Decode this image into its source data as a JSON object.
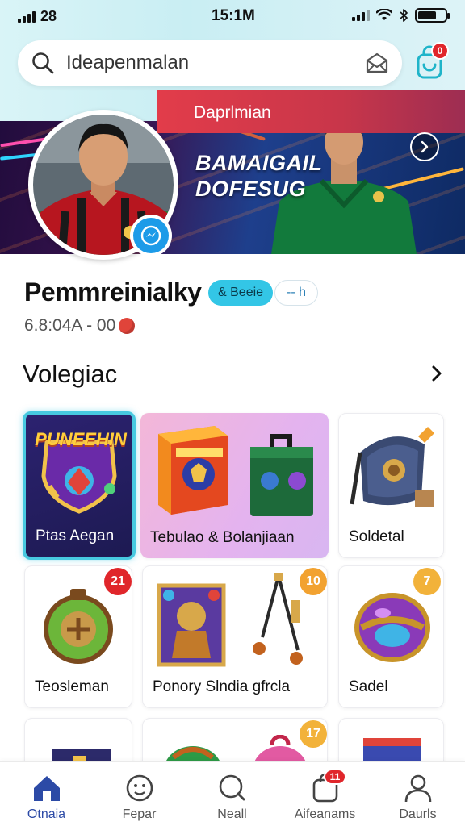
{
  "status_bar": {
    "carrier": "28",
    "time": "15:1M"
  },
  "search": {
    "value": "Ideapenmalan",
    "search_icon": "search-icon",
    "mail_icon": "mail-icon",
    "bag_icon": "shopping-bag-icon",
    "bag_badge": "0"
  },
  "hero": {
    "title_line1": "BAMAIGAIL",
    "title_line2": "DOFESUG",
    "band_text": "Daprlmian",
    "next_icon": "chevron-right-icon"
  },
  "profile": {
    "name": "Pemmreinialky",
    "follow_label": "& Beeie",
    "message_label": "-- h",
    "stats": "6.8:04A - 00",
    "verified_icon": "messenger-check-icon"
  },
  "section": {
    "title": "Volegiac",
    "more_icon": "chevron-right-icon"
  },
  "cards": [
    {
      "label": "Ptas Aegan",
      "art_title": "PUNEEHIN",
      "badge": ""
    },
    {
      "label": "Tebulao & Bolanjiaan",
      "badge": ""
    },
    {
      "label": "Soldetal",
      "badge": ""
    },
    {
      "label": "Teosleman",
      "badge": "21",
      "badge_color": "#e0262b"
    },
    {
      "label": "Ponory Slndia gfrcla",
      "badge": "10",
      "badge_color": "#f2a230"
    },
    {
      "label": "Sadel",
      "badge": "7",
      "badge_color": "#f2b23a"
    },
    {
      "label": "",
      "badge": ""
    },
    {
      "label": "",
      "badge": ""
    },
    {
      "label": "",
      "badge": "17",
      "badge_color": "#f2b23a"
    },
    {
      "label": "",
      "badge": ""
    }
  ],
  "bottom_nav": [
    {
      "label": "Otnaia",
      "icon": "home-icon",
      "active": true
    },
    {
      "label": "Fepar",
      "icon": "emoji-icon",
      "active": false
    },
    {
      "label": "Neall",
      "icon": "search-icon",
      "active": false
    },
    {
      "label": "Aifeanams",
      "icon": "bag-icon",
      "active": false,
      "badge": "11"
    },
    {
      "label": "Daurls",
      "icon": "profile-icon",
      "active": false
    }
  ],
  "colors": {
    "accent": "#33c6e6",
    "badge_red": "#e0262b",
    "nav_active": "#2c4aa6"
  }
}
